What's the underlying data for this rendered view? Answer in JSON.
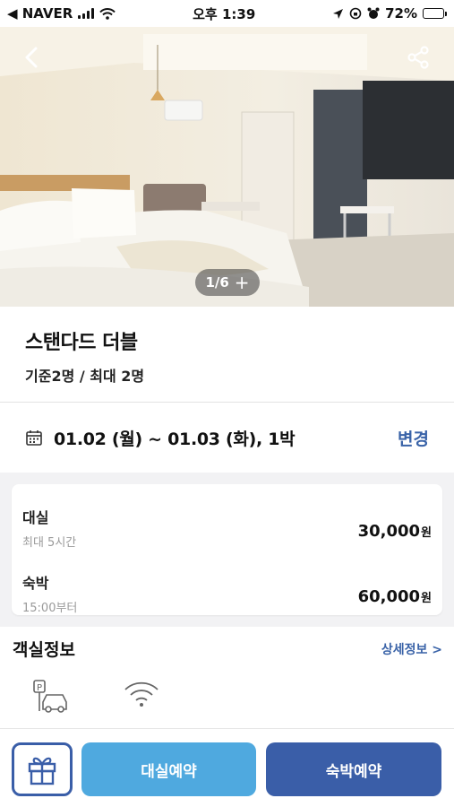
{
  "status_bar": {
    "back_app": "◀ NAVER",
    "time": "오후 1:39",
    "battery": "72%",
    "battery_level": 0.72
  },
  "hero": {
    "counter": "1/6",
    "counter_plus": "+",
    "icons": {
      "back": "chevron-left-icon",
      "share": "share-icon"
    }
  },
  "room": {
    "name": "스탠다드 더블",
    "occupancy": "기준2명 / 최대 2명"
  },
  "booking_dates": {
    "text": "01.02 (월) ~ 01.03 (화), 1박",
    "change_label": "변경",
    "icon": "calendar-icon"
  },
  "prices": [
    {
      "name": "대실",
      "sub": "최대 5시간",
      "price": "30,000",
      "unit": "원"
    },
    {
      "name": "숙박",
      "sub": "15:00부터",
      "price": "60,000",
      "unit": "원"
    }
  ],
  "room_info": {
    "title": "객실정보",
    "detail_link": "상세정보 >",
    "amenities": [
      "parking-icon",
      "wifi-icon"
    ]
  },
  "bottom": {
    "gift_icon": "gift-icon",
    "rent_label": "대실예약",
    "stay_label": "숙박예약"
  },
  "colors": {
    "accent": "#3a5ea8",
    "light_accent": "#4fa9df",
    "link": "#3a63a8"
  }
}
